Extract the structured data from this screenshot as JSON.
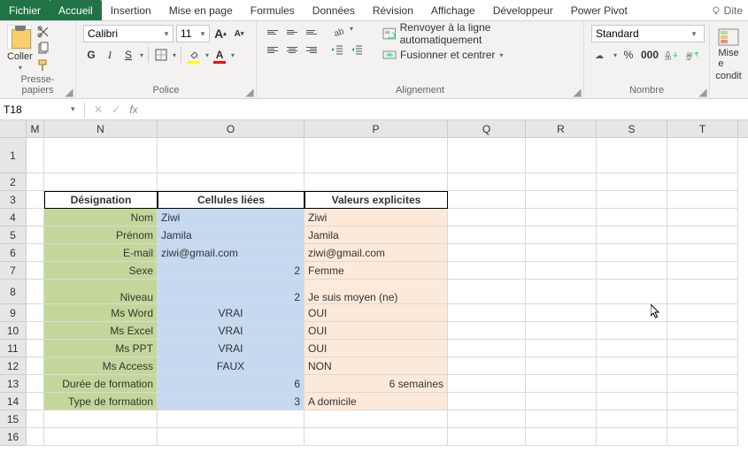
{
  "tabs": {
    "file": "Fichier",
    "home": "Accueil",
    "insert": "Insertion",
    "layout": "Mise en page",
    "formulas": "Formules",
    "data": "Données",
    "review": "Révision",
    "view": "Affichage",
    "developer": "Développeur",
    "powerpivot": "Power Pivot",
    "tell": "Dite"
  },
  "ribbon": {
    "clipboard": {
      "label": "Presse-papiers",
      "paste": "Coller"
    },
    "font": {
      "label": "Police",
      "name": "Calibri",
      "size": "11",
      "bold": "G",
      "italic": "I",
      "underline": "S",
      "strike": ""
    },
    "align": {
      "label": "Alignement",
      "wrap": "Renvoyer à la ligne automatiquement",
      "merge": "Fusionner et centrer"
    },
    "number": {
      "label": "Nombre",
      "format": "Standard"
    },
    "styles": {
      "cf1": "Mise e",
      "cf2": "condit"
    }
  },
  "fbar": {
    "name": "T18",
    "formula": ""
  },
  "cols": [
    "M",
    "N",
    "O",
    "P",
    "Q",
    "R",
    "S",
    "T"
  ],
  "rows": [
    "1",
    "2",
    "3",
    "4",
    "5",
    "6",
    "7",
    "8",
    "9",
    "10",
    "11",
    "12",
    "13",
    "14",
    "15",
    "16"
  ],
  "table": {
    "headers": {
      "n": "Désignation",
      "o": "Cellules liées",
      "p": "Valeurs explicites"
    },
    "rows": [
      {
        "n": "Nom",
        "o": "Ziwi",
        "p": "Ziwi"
      },
      {
        "n": "Prénom",
        "o": "Jamila",
        "p": "Jamila"
      },
      {
        "n": "E-mail",
        "o": "ziwi@gmail.com",
        "p": "ziwi@gmail.com"
      },
      {
        "n": "Sexe",
        "o": "2",
        "p": "Femme"
      },
      {
        "n": "",
        "o": "",
        "p": ""
      },
      {
        "n": "Niveau",
        "o": "2",
        "p": "Je suis moyen (ne)"
      },
      {
        "n": "Ms Word",
        "o": "VRAI",
        "p": "OUI"
      },
      {
        "n": "Ms Excel",
        "o": "VRAI",
        "p": "OUI"
      },
      {
        "n": "Ms PPT",
        "o": "VRAI",
        "p": "OUI"
      },
      {
        "n": "Ms Access",
        "o": "FAUX",
        "p": "NON"
      },
      {
        "n": "Durée de formation",
        "o": "6",
        "p": "6 semaines"
      },
      {
        "n": "Type de formation",
        "o": "3",
        "p": "A domicile"
      }
    ]
  }
}
